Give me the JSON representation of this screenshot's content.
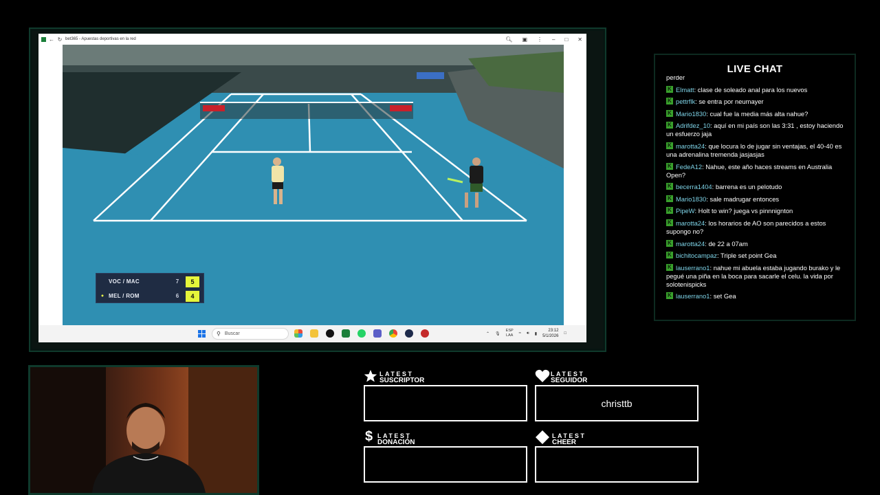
{
  "browser": {
    "tab_title": "bet365 - Apuestas deportivas en la red"
  },
  "scoreboard": {
    "rows": [
      {
        "team": "VOC / MAC",
        "set1": "7",
        "set2": "5",
        "serving": false
      },
      {
        "team": "MEL / ROM",
        "set1": "6",
        "set2": "4",
        "serving": true
      }
    ]
  },
  "taskbar": {
    "search_placeholder": "Buscar",
    "lang_top": "ESP",
    "lang_bottom": "LAA",
    "time": "23:12",
    "date": "5/1/2026"
  },
  "chat": {
    "title": "LIVE CHAT",
    "partial_top": "perder",
    "messages": [
      {
        "user": "Elmatt",
        "text": "clase de soleado anal para los nuevos"
      },
      {
        "user": "pettrflk",
        "text": "se entra por neumayer"
      },
      {
        "user": "Mario1830",
        "text": "cual fue la media más alta nahue?"
      },
      {
        "user": "Adrifdez_10",
        "text": "aquí en mi país son las 3:31 , estoy haciendo un esfuerzo jaja"
      },
      {
        "user": "marotta24",
        "text": "que locura lo de jugar sin ventajas, el 40-40 es una adrenalina tremenda jasjasjas"
      },
      {
        "user": "FedeA12",
        "text": "Nahue, este año haces streams en Australia Open?"
      },
      {
        "user": "becerra1404",
        "text": "barrena es un pelotudo"
      },
      {
        "user": "Mario1830",
        "text": "sale madrugar entonces"
      },
      {
        "user": "PipeW",
        "text": "Holt to win? juega vs pinnnignton"
      },
      {
        "user": "marotta24",
        "text": "los horarios de AO son parecidos a estos supongo no?"
      },
      {
        "user": "marotta24",
        "text": "de 22 a 07am"
      },
      {
        "user": "bichitocampaz",
        "text": "Triple set point Gea"
      },
      {
        "user": "lauserrano1",
        "text": "nahue mi abuela estaba jugando burako y le pegué una piña en la boca para sacarle el celu. la vida por solotenispicks"
      },
      {
        "user": "lauserrano1",
        "text": "set Gea"
      }
    ]
  },
  "latest": {
    "suscriptor": {
      "small": "LATEST",
      "big": "SUSCRIPTOR",
      "value": ""
    },
    "seguidor": {
      "small": "LATEST",
      "big": "SEGUIDOR",
      "value": "christtb"
    },
    "donacion": {
      "small": "LATEST",
      "big": "DONACIÓN",
      "value": ""
    },
    "cheer": {
      "small": "LATEST",
      "big": "CHEER",
      "value": ""
    }
  },
  "colors": {
    "frame_green": "#0f3a2c",
    "court_blue": "#2f8fb2",
    "chat_username": "#7fd5e9",
    "chat_badge": "#39a02c",
    "score_highlight": "#e6f53a"
  }
}
